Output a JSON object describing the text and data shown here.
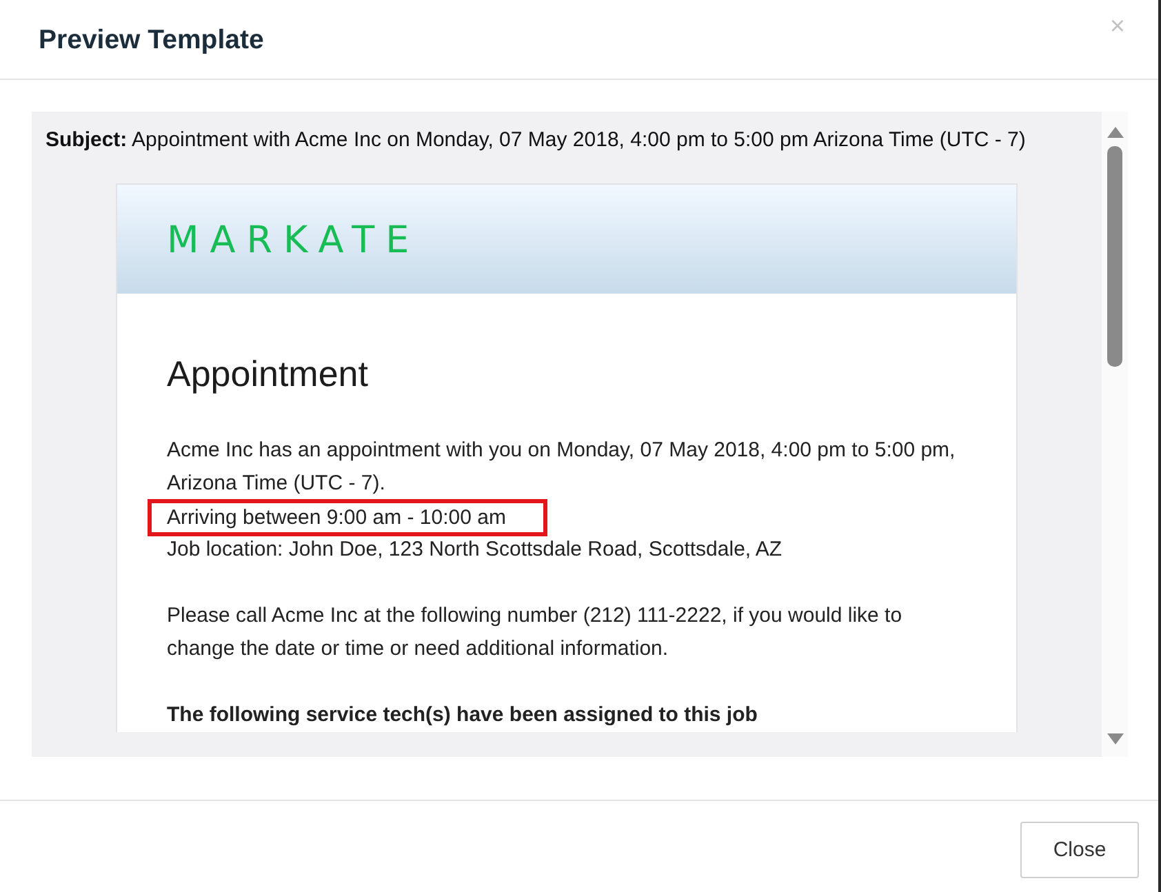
{
  "dialog": {
    "title": "Preview Template",
    "close_label": "×"
  },
  "preview": {
    "subject": "**Subject:** Appointment with Acme Inc on Monday, 07 May 2018, 4:00 pm to 5:00 pm Arizona Time (UTC - 7)",
    "email": {
      "logo": "MARKATE",
      "heading": "Appointment",
      "blocks": [
        {
          "kind": "text",
          "lines": [
            {
              "text": "Acme Inc has an appointment with you on Monday, 07 May 2018, 4:00 pm to 5:00 pm, Arizona Time (UTC - 7).",
              "highlighted": false
            },
            {
              "text": "Arriving between 9:00 am - 10:00 am",
              "highlighted": true
            },
            {
              "text": "Job location: John Doe, 123 North Scottsdale Road, Scottsdale, AZ",
              "highlighted": false
            }
          ]
        },
        {
          "kind": "text",
          "lines": [
            {
              "text": "Please call Acme Inc at the following number (212) 111-2222, if you would like to change the date or time or need additional information.",
              "highlighted": false
            }
          ]
        },
        {
          "kind": "bold",
          "lines": [
            {
              "text": "The following service tech(s) have been assigned to this job",
              "highlighted": false
            }
          ]
        }
      ]
    }
  },
  "footer": {
    "buttons": [
      "Close"
    ]
  }
}
